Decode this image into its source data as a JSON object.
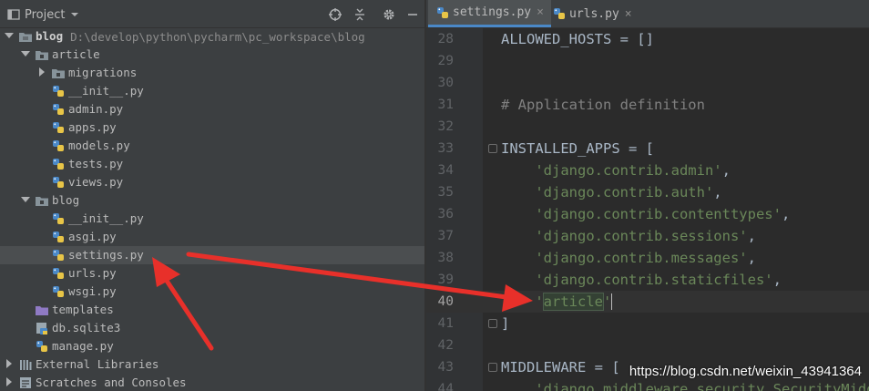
{
  "project_panel": {
    "title": "Project",
    "toolbar_icons": [
      "locate-icon",
      "collapse-icon",
      "settings-gear-icon",
      "hide-icon"
    ]
  },
  "tree": [
    {
      "label": "blog",
      "path": "D:\\develop\\python\\pycharm\\pc_workspace\\blog",
      "kind": "folder",
      "expanded": true,
      "depth": 0,
      "bold": true
    },
    {
      "label": "article",
      "kind": "package",
      "expanded": true,
      "depth": 1
    },
    {
      "label": "migrations",
      "kind": "package",
      "expanded": false,
      "depth": 2
    },
    {
      "label": "__init__.py",
      "kind": "python",
      "depth": 2
    },
    {
      "label": "admin.py",
      "kind": "python",
      "depth": 2
    },
    {
      "label": "apps.py",
      "kind": "python",
      "depth": 2
    },
    {
      "label": "models.py",
      "kind": "python",
      "depth": 2
    },
    {
      "label": "tests.py",
      "kind": "python",
      "depth": 2
    },
    {
      "label": "views.py",
      "kind": "python",
      "depth": 2
    },
    {
      "label": "blog",
      "kind": "package",
      "expanded": true,
      "depth": 1
    },
    {
      "label": "__init__.py",
      "kind": "python",
      "depth": 2
    },
    {
      "label": "asgi.py",
      "kind": "python",
      "depth": 2
    },
    {
      "label": "settings.py",
      "kind": "python",
      "depth": 2,
      "selected": true
    },
    {
      "label": "urls.py",
      "kind": "python",
      "depth": 2
    },
    {
      "label": "wsgi.py",
      "kind": "python",
      "depth": 2
    },
    {
      "label": "templates",
      "kind": "folder-purple",
      "depth": 1
    },
    {
      "label": "db.sqlite3",
      "kind": "db",
      "depth": 1
    },
    {
      "label": "manage.py",
      "kind": "python",
      "depth": 1
    },
    {
      "label": "External Libraries",
      "kind": "libraries",
      "expanded": false,
      "depth": 0
    },
    {
      "label": "Scratches and Consoles",
      "kind": "scratches",
      "expanded": false,
      "depth": 0
    }
  ],
  "tabs": [
    {
      "label": "settings.py",
      "active": true,
      "close": "×"
    },
    {
      "label": "urls.py",
      "active": false,
      "close": "×"
    }
  ],
  "code_lines": [
    {
      "num": "28",
      "parts": [
        {
          "t": "ALLOWED_HOSTS = []",
          "c": "plain"
        }
      ]
    },
    {
      "num": "29",
      "parts": []
    },
    {
      "num": "30",
      "parts": []
    },
    {
      "num": "31",
      "parts": [
        {
          "t": "# Application definition",
          "c": "cmt"
        }
      ]
    },
    {
      "num": "32",
      "parts": []
    },
    {
      "num": "33",
      "fold": true,
      "parts": [
        {
          "t": "INSTALLED_APPS = [",
          "c": "plain"
        }
      ]
    },
    {
      "num": "34",
      "parts": [
        {
          "t": "    ",
          "c": "plain"
        },
        {
          "t": "'django.contrib.admin'",
          "c": "str"
        },
        {
          "t": ",",
          "c": "plain"
        }
      ]
    },
    {
      "num": "35",
      "parts": [
        {
          "t": "    ",
          "c": "plain"
        },
        {
          "t": "'django.contrib.auth'",
          "c": "str"
        },
        {
          "t": ",",
          "c": "plain"
        }
      ]
    },
    {
      "num": "36",
      "parts": [
        {
          "t": "    ",
          "c": "plain"
        },
        {
          "t": "'django.contrib.contenttypes'",
          "c": "str"
        },
        {
          "t": ",",
          "c": "plain"
        }
      ]
    },
    {
      "num": "37",
      "parts": [
        {
          "t": "    ",
          "c": "plain"
        },
        {
          "t": "'django.contrib.sessions'",
          "c": "str"
        },
        {
          "t": ",",
          "c": "plain"
        }
      ]
    },
    {
      "num": "38",
      "parts": [
        {
          "t": "    ",
          "c": "plain"
        },
        {
          "t": "'django.contrib.messages'",
          "c": "str"
        },
        {
          "t": ",",
          "c": "plain"
        }
      ]
    },
    {
      "num": "39",
      "parts": [
        {
          "t": "    ",
          "c": "plain"
        },
        {
          "t": "'django.contrib.staticfiles'",
          "c": "str"
        },
        {
          "t": ",",
          "c": "plain"
        }
      ]
    },
    {
      "num": "40",
      "current": true,
      "parts": [
        {
          "t": "    ",
          "c": "plain"
        },
        {
          "t": "'",
          "c": "str"
        },
        {
          "t": "article",
          "c": "str-hl"
        },
        {
          "t": "'",
          "c": "str"
        },
        {
          "t": "",
          "c": "caret"
        }
      ]
    },
    {
      "num": "41",
      "fold": true,
      "parts": [
        {
          "t": "]",
          "c": "plain"
        }
      ]
    },
    {
      "num": "42",
      "parts": []
    },
    {
      "num": "43",
      "fold": true,
      "parts": [
        {
          "t": "MIDDLEWARE = [",
          "c": "plain"
        }
      ]
    },
    {
      "num": "44",
      "parts": [
        {
          "t": "    ",
          "c": "plain"
        },
        {
          "t": "'django.middleware.security.SecurityMiddleware'",
          "c": "str"
        }
      ]
    }
  ],
  "watermark": "https://blog.csdn.net/weixin_43941364",
  "colors": {
    "arrow": "#e8302a",
    "string": "#6a8759",
    "comment": "#808080",
    "code": "#a9b7c6"
  }
}
